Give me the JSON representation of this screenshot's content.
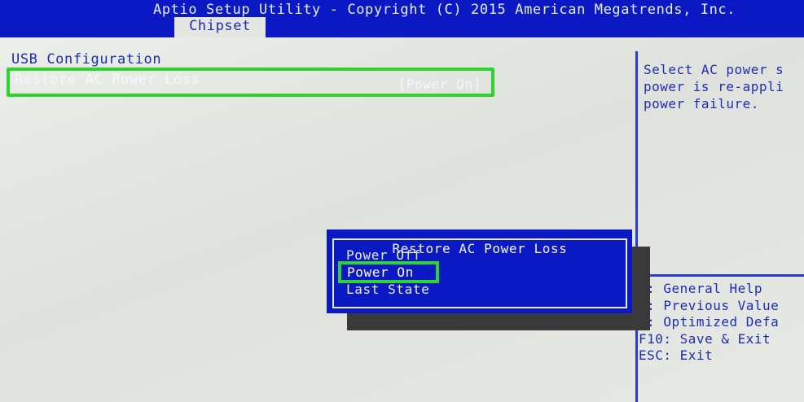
{
  "header": {
    "title": "Aptio Setup Utility - Copyright (C) 2015 American Megatrends, Inc.",
    "active_tab": "Chipset"
  },
  "main": {
    "section_title": "USB Configuration",
    "setting": {
      "label": "Restore AC Power Loss",
      "value": "[Power On]"
    }
  },
  "help_panel": {
    "text": "Select AC power s\npower is re-appli\npower failure."
  },
  "key_legend": {
    "text": "1: General Help\n2: Previous Value\n9: Optimized Defa\nF10: Save & Exit\nESC: Exit"
  },
  "popup": {
    "title": "Restore AC Power Loss",
    "options": [
      "Power Off",
      "Power On",
      "Last State"
    ],
    "selected_option": "Power On"
  },
  "colors": {
    "bios_blue": "#0b19c4",
    "background": "#e4e6e2",
    "highlight_green": "#2bd62b"
  }
}
